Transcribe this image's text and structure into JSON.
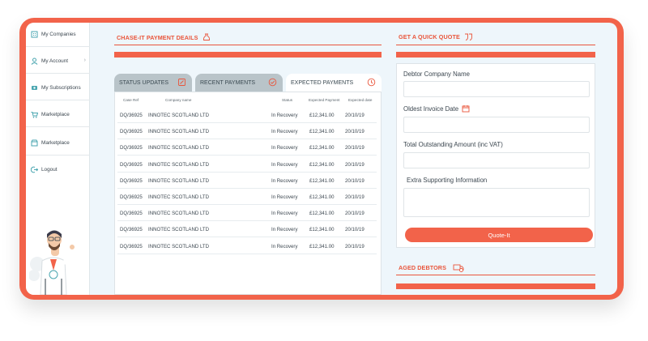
{
  "sidebar": {
    "items": [
      {
        "label": "My Companies",
        "icon": "building-icon"
      },
      {
        "label": "My Account",
        "icon": "user-icon"
      },
      {
        "label": "My Subscriptions",
        "icon": "subscriptions-icon"
      },
      {
        "label": "Marketplace",
        "icon": "cart-icon"
      },
      {
        "label": "Marketplace",
        "icon": "store-icon"
      },
      {
        "label": "Logout",
        "icon": "logout-icon"
      }
    ]
  },
  "chase": {
    "title": "CHASE-IT PAYMENT DEAILS",
    "tabs": [
      {
        "label": "STATUS UPDATES"
      },
      {
        "label": "RECENT PAYMENTS"
      },
      {
        "label": "EXPECTED PAYMENTS"
      }
    ],
    "table": {
      "headers": [
        "Case Ref",
        "Company name",
        "Status",
        "Expected Payment",
        "Expected date"
      ],
      "rows": [
        [
          "DQ/36925",
          "INNOTEC SCOTLAND LTD",
          "In Recovery",
          "£12,341.00",
          "20/10/19"
        ],
        [
          "DQ/36925",
          "INNOTEC SCOTLAND LTD",
          "In Recovery",
          "£12,341.00",
          "20/10/19"
        ],
        [
          "DQ/36925",
          "INNOTEC SCOTLAND LTD",
          "In Recovery",
          "£12,341.00",
          "20/10/19"
        ],
        [
          "DQ/36925",
          "INNOTEC SCOTLAND LTD",
          "In Recovery",
          "£12,341.00",
          "20/10/19"
        ],
        [
          "DQ/36925",
          "INNOTEC SCOTLAND LTD",
          "In Recovery",
          "£12,341.00",
          "20/10/19"
        ],
        [
          "DQ/36925",
          "INNOTEC SCOTLAND LTD",
          "In Recovery",
          "£12,341.00",
          "20/10/19"
        ],
        [
          "DQ/36925",
          "INNOTEC SCOTLAND LTD",
          "In Recovery",
          "£12,341.00",
          "20/10/19"
        ],
        [
          "DQ/36925",
          "INNOTEC SCOTLAND LTD",
          "In Recovery",
          "£12,341.00",
          "20/10/19"
        ],
        [
          "DQ/36925",
          "INNOTEC SCOTLAND LTD",
          "In Recovery",
          "£12,341.00",
          "20/10/19"
        ]
      ]
    }
  },
  "quote": {
    "title": "GET A QUICK QUOTE",
    "fields": {
      "debtor": "Debtor Company Name",
      "oldest": "Oldest Invoice Date",
      "total": "Total Outstanding Amount (inc VAT)",
      "extra": "Extra Supporting Information"
    },
    "button": "Quote-It"
  },
  "aged": {
    "title": "AGED DEBTORS"
  },
  "colors": {
    "accent": "#f2634a",
    "tab_inactive": "#b9c4c9",
    "background": "#eef6fb"
  }
}
